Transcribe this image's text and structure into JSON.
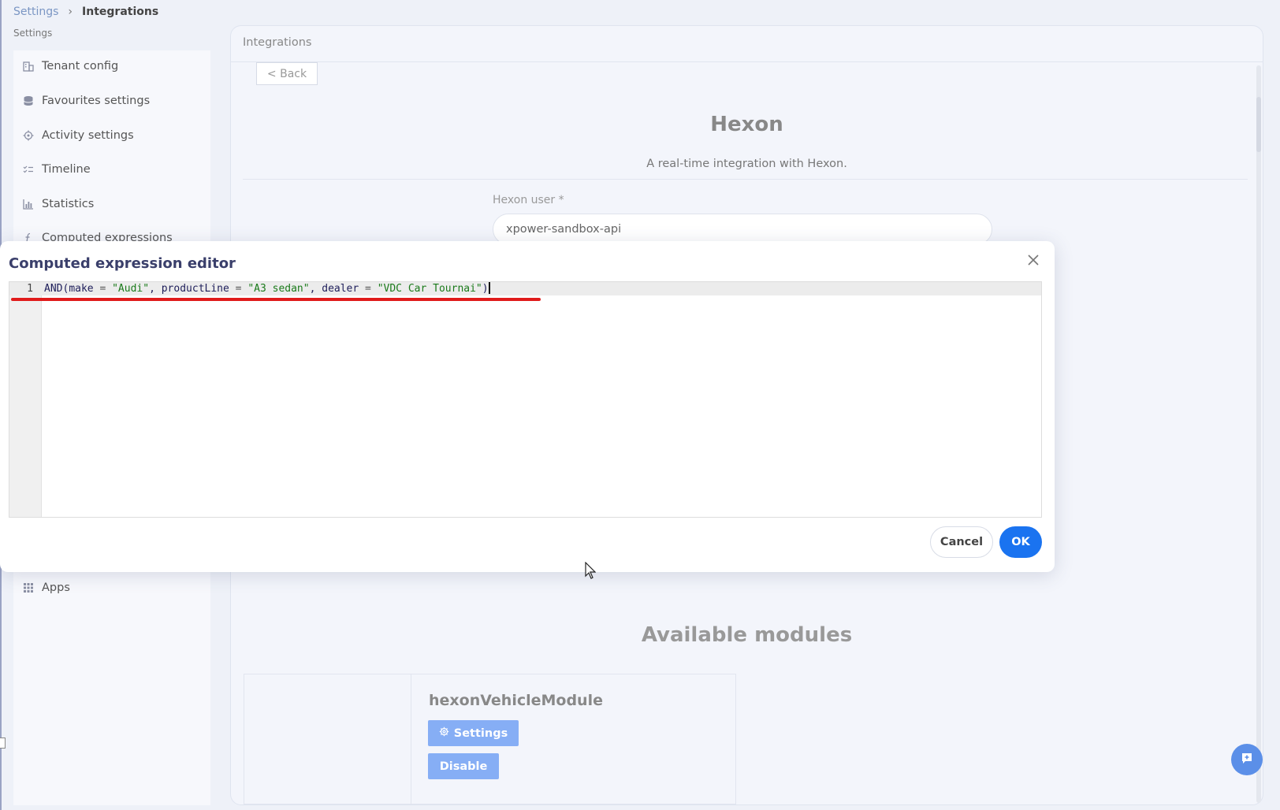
{
  "breadcrumb": {
    "root": "Settings",
    "separator": "›",
    "current": "Integrations"
  },
  "subtitle": "Settings",
  "sidebar": {
    "items": [
      {
        "label": "Tenant config",
        "icon": "building-icon"
      },
      {
        "label": "Favourites settings",
        "icon": "database-icon"
      },
      {
        "label": "Activity settings",
        "icon": "activity-gear-icon"
      },
      {
        "label": "Timeline",
        "icon": "checklist-icon"
      },
      {
        "label": "Statistics",
        "icon": "bar-chart-icon"
      },
      {
        "label": "Computed expressions",
        "icon": "function-icon"
      },
      {
        "label": "Apps",
        "icon": "grid-icon"
      }
    ]
  },
  "panel": {
    "title": "Integrations",
    "back_label": "< Back",
    "integration_name": "Hexon",
    "integration_desc": "A real-time integration with Hexon.",
    "user_field_label": "Hexon user *",
    "user_field_value": "xpower-sandbox-api",
    "modules_title": "Available modules",
    "module": {
      "name": "hexonVehicleModule",
      "settings_label": "Settings",
      "disable_label": "Disable"
    }
  },
  "modal": {
    "title": "Computed expression editor",
    "line_number": "1",
    "code": {
      "fn": "AND(",
      "p1": "make",
      "eq": " = ",
      "v1": "\"Audi\"",
      "c": ", ",
      "p2": "productLine",
      "v2": "\"A3 sedan\"",
      "p3": "dealer",
      "v3": "\"VDC Car Tournai\"",
      "close": ")"
    },
    "cancel_label": "Cancel",
    "ok_label": "OK"
  },
  "colors": {
    "accent": "#1a73f0",
    "module_button": "#86aef5",
    "annotation_underline": "#e01b1b"
  }
}
